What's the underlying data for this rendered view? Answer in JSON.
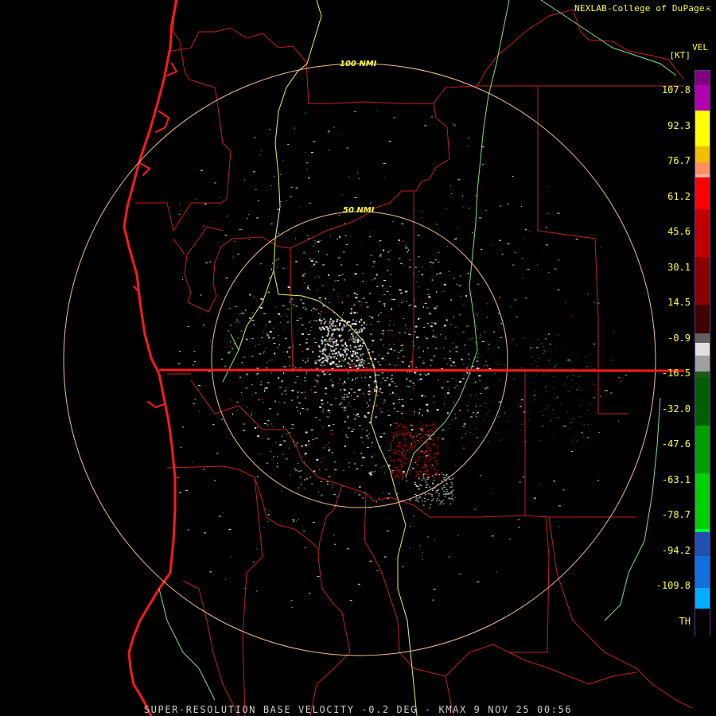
{
  "credit": {
    "text": "NEXLAB-College of DuPage",
    "logo_icon": "corner-arrow-icon"
  },
  "legend": {
    "title": "VEL",
    "unit": "[KT]",
    "ticks": [
      "107.8",
      "92.3",
      "76.7",
      "61.2",
      "45.6",
      "30.1",
      "14.5",
      "-0.9",
      "-16.5",
      "-32.0",
      "-47.6",
      "-63.1",
      "-78.7",
      "-94.2",
      "-109.8",
      "TH"
    ]
  },
  "rings": {
    "inner": "50 NMI",
    "outer": "100 NMI"
  },
  "footer": {
    "text": "SUPER-RESOLUTION BASE VELOCITY -0.2 DEG - KMAX 9 NOV 25 00:56"
  },
  "colors": {
    "coastline": "#ff1a1a",
    "county_lines": "#c42020",
    "highways": "#f0f060",
    "rivers": "#80e080",
    "range_rings": "#f0c090",
    "text_yellow": "#ffff33"
  }
}
